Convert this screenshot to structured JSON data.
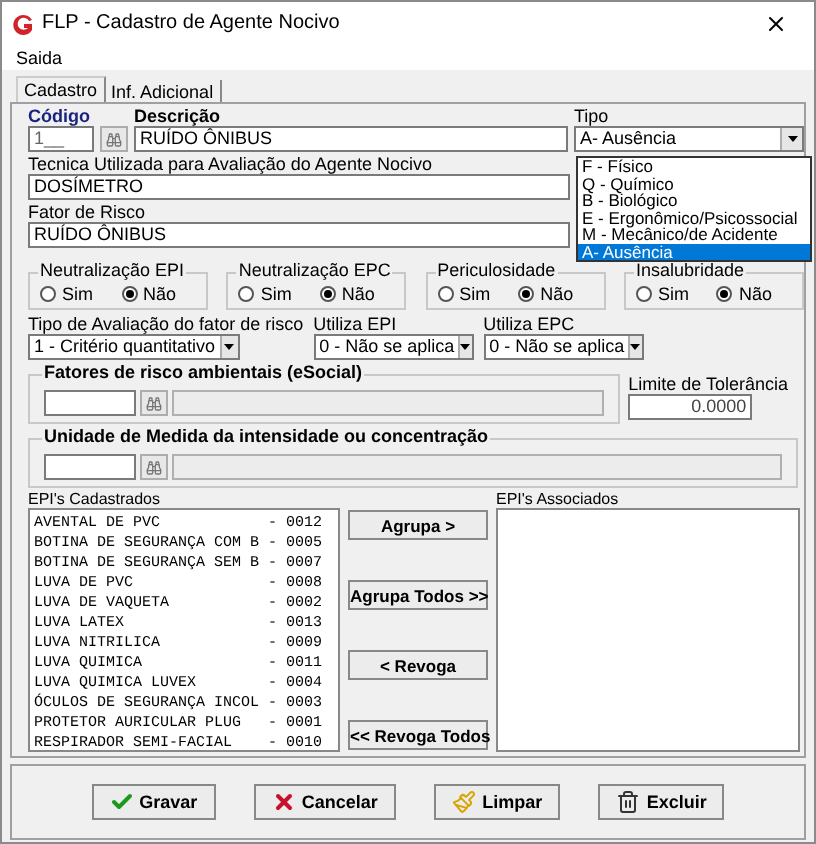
{
  "window": {
    "title": "FLP - Cadastro de Agente Nocivo"
  },
  "menu": [
    "Saida"
  ],
  "tabs": [
    {
      "label": "Cadastro",
      "selected": true
    },
    {
      "label": "Inf. Adicional",
      "selected": false
    }
  ],
  "codigo": {
    "label": "Código",
    "value": "1__"
  },
  "descricao": {
    "label": "Descrição",
    "value": "RUÍDO ÔNIBUS"
  },
  "tipo": {
    "label": "Tipo",
    "value": "A- Ausência",
    "expanded": true,
    "options": [
      {
        "label": "F - Físico",
        "selected": false
      },
      {
        "label": "Q - Químico",
        "selected": false
      },
      {
        "label": "B - Biológico",
        "selected": false
      },
      {
        "label": "E - Ergonômico/Psicossocial",
        "selected": false
      },
      {
        "label": "M - Mecânico/de Acidente",
        "selected": false
      },
      {
        "label": "A- Ausência",
        "selected": true
      }
    ]
  },
  "tecnica": {
    "label": "Tecnica Utilizada para Avaliação do Agente Nocivo",
    "value": "DOSÍMETRO"
  },
  "fator": {
    "label": "Fator de Risco",
    "value": "RUÍDO ÔNIBUS"
  },
  "radio_groups": [
    {
      "label": "Neutralização EPI",
      "options": [
        {
          "label": "Sim",
          "selected": false
        },
        {
          "label": "Não",
          "selected": true
        }
      ]
    },
    {
      "label": "Neutralização EPC",
      "options": [
        {
          "label": "Sim",
          "selected": false
        },
        {
          "label": "Não",
          "selected": true
        }
      ]
    },
    {
      "label": "Periculosidade",
      "options": [
        {
          "label": "Sim",
          "selected": false
        },
        {
          "label": "Não",
          "selected": true
        }
      ]
    },
    {
      "label": "Insalubridade",
      "options": [
        {
          "label": "Sim",
          "selected": false
        },
        {
          "label": "Não",
          "selected": true
        }
      ]
    }
  ],
  "selects": [
    {
      "label": "Tipo de Avaliação do fator de risco",
      "value": "1 - Critério quantitativo"
    },
    {
      "label": "Utiliza EPI",
      "value": "0 - Não se aplica"
    },
    {
      "label": "Utiliza EPC",
      "value": "0 - Não se aplica"
    }
  ],
  "fatores": {
    "label": "Fatores de risco ambientais (eSocial)"
  },
  "limite": {
    "label": "Limite de Tolerância",
    "value": "0.0000"
  },
  "unidade": {
    "label": "Unidade de Medida da intensidade ou concentração"
  },
  "epi_cadastrados": {
    "label": "EPI's Cadastrados",
    "items": [
      "AVENTAL DE PVC            - 0012",
      "BOTINA DE SEGURANÇA COM B - 0005",
      "BOTINA DE SEGURANÇA SEM B - 0007",
      "LUVA DE PVC               - 0008",
      "LUVA DE VAQUETA           - 0002",
      "LUVA LATEX                - 0013",
      "LUVA NITRILICA            - 0009",
      "LUVA QUIMICA              - 0011",
      "LUVA QUIMICA LUVEX        - 0004",
      "ÓCULOS DE SEGURANÇA INCOL - 0003",
      "PROTETOR AURICULAR PLUG   - 0001",
      "RESPIRADOR SEMI-FACIAL    - 0010"
    ]
  },
  "transfer_buttons": [
    "Agrupa >",
    "Agrupa Todos >>",
    "< Revoga",
    "<< Revoga Todos"
  ],
  "epi_associados": {
    "label": "EPI's Associados"
  },
  "buttons": [
    {
      "label": "Gravar",
      "kind": "save"
    },
    {
      "label": "Cancelar",
      "kind": "cancel"
    },
    {
      "label": "Limpar",
      "kind": "clear"
    },
    {
      "label": "Excluir",
      "kind": "delete"
    }
  ]
}
